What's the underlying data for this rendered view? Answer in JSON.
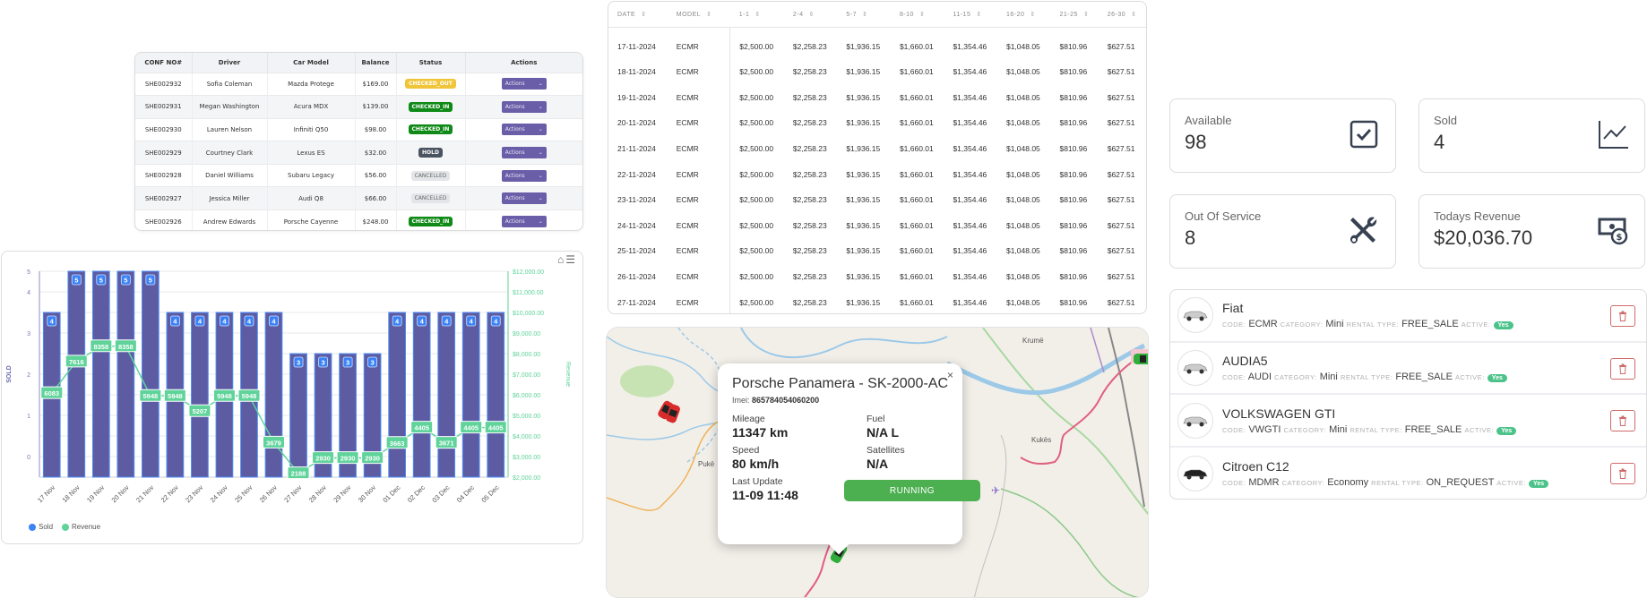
{
  "bookings": {
    "headers": [
      "CONF NO#",
      "Driver",
      "Car Model",
      "Balance",
      "Status",
      "Actions"
    ],
    "rows": [
      {
        "conf": "SHE002932",
        "driver": "Sofia Coleman",
        "model": "Mazda Protege",
        "balance": "$169.00",
        "status": "CHECKED_OUT",
        "action": "Actions"
      },
      {
        "conf": "SHE002931",
        "driver": "Megan Washington",
        "model": "Acura MDX",
        "balance": "$139.00",
        "status": "CHECKED_IN",
        "action": "Actions"
      },
      {
        "conf": "SHE002930",
        "driver": "Lauren Nelson",
        "model": "Infiniti Q50",
        "balance": "$98.00",
        "status": "CHECKED_IN",
        "action": "Actions"
      },
      {
        "conf": "SHE002929",
        "driver": "Courtney Clark",
        "model": "Lexus ES",
        "balance": "$32.00",
        "status": "HOLD",
        "action": "Actions"
      },
      {
        "conf": "SHE002928",
        "driver": "Daniel Williams",
        "model": "Subaru Legacy",
        "balance": "$56.00",
        "status": "CANCELLED",
        "action": "Actions"
      },
      {
        "conf": "SHE002927",
        "driver": "Jessica Miller",
        "model": "Audi Q8",
        "balance": "$66.00",
        "status": "CANCELLED",
        "action": "Actions"
      },
      {
        "conf": "SHE002926",
        "driver": "Andrew Edwards",
        "model": "Porsche Cayenne",
        "balance": "$248.00",
        "status": "CHECKED_IN",
        "action": "Actions"
      }
    ],
    "status_colors": {
      "CHECKED_OUT": "#f0c53a",
      "CHECKED_IN": "#0f8a17",
      "HOLD": "#4a5361",
      "CANCELLED": "#e3e5e8"
    },
    "action_color": "#6a5ea8"
  },
  "chart_data": {
    "type": "bar",
    "title": "",
    "categories": [
      "17 Nov",
      "18 Nov",
      "19 Nov",
      "20 Nov",
      "21 Nov",
      "22 Nov",
      "23 Nov",
      "24 Nov",
      "25 Nov",
      "26 Nov",
      "27 Nov",
      "28 Nov",
      "29 Nov",
      "30 Nov",
      "01 Dec",
      "02 Dec",
      "03 Dec",
      "04 Dec",
      "05 Dec"
    ],
    "series": [
      {
        "name": "Sold",
        "type": "bar",
        "axis": "left",
        "color": "#5d5ca3",
        "legend_color": "#3b82f6",
        "values": [
          4,
          5,
          5,
          5,
          5,
          4,
          4,
          4,
          4,
          4,
          3,
          3,
          3,
          3,
          4,
          4,
          4,
          4,
          4
        ]
      },
      {
        "name": "Revenue",
        "type": "line",
        "axis": "right",
        "color": "#5fd39a",
        "values": [
          6083,
          7616,
          8358,
          8358,
          5948,
          5948,
          5207,
          5948,
          5948,
          3679,
          2188,
          2930,
          2930,
          2930,
          3663,
          4405,
          3671,
          4405,
          4405
        ]
      }
    ],
    "ylabel": "SOLD",
    "y2label": "Revenue",
    "y_ticks": [
      "0",
      "1",
      "2",
      "3",
      "4",
      "5"
    ],
    "y2_ticks": [
      "$2,000.00",
      "$3,000.00",
      "$4,000.00",
      "$5,000.00",
      "$6,000.00",
      "$7,000.00",
      "$8,000.00",
      "$9,000.00",
      "$10,000.00",
      "$11,000.00",
      "$12,000.00"
    ],
    "y2lim": [
      2000,
      12000
    ],
    "grid": true,
    "legend": "bottom-left"
  },
  "chart_tools": {
    "home_icon": "home-icon",
    "menu_icon": "menu-icon"
  },
  "pricing": {
    "headers": [
      "DATE",
      "MODEL",
      "1-1",
      "2-4",
      "5-7",
      "8-10",
      "11-15",
      "16-20",
      "21-25",
      "26-30"
    ],
    "rows": [
      [
        "17-11-2024",
        "ECMR",
        "$2,500.00",
        "$2,258.23",
        "$1,936.15",
        "$1,660.01",
        "$1,354.46",
        "$1,048.05",
        "$810.96",
        "$627.51"
      ],
      [
        "18-11-2024",
        "ECMR",
        "$2,500.00",
        "$2,258.23",
        "$1,936.15",
        "$1,660.01",
        "$1,354.46",
        "$1,048.05",
        "$810.96",
        "$627.51"
      ],
      [
        "19-11-2024",
        "ECMR",
        "$2,500.00",
        "$2,258.23",
        "$1,936.15",
        "$1,660.01",
        "$1,354.46",
        "$1,048.05",
        "$810.96",
        "$627.51"
      ],
      [
        "20-11-2024",
        "ECMR",
        "$2,500.00",
        "$2,258.23",
        "$1,936.15",
        "$1,660.01",
        "$1,354.46",
        "$1,048.05",
        "$810.96",
        "$627.51"
      ],
      [
        "21-11-2024",
        "ECMR",
        "$2,500.00",
        "$2,258.23",
        "$1,936.15",
        "$1,660.01",
        "$1,354.46",
        "$1,048.05",
        "$810.96",
        "$627.51"
      ],
      [
        "22-11-2024",
        "ECMR",
        "$2,500.00",
        "$2,258.23",
        "$1,936.15",
        "$1,660.01",
        "$1,354.46",
        "$1,048.05",
        "$810.96",
        "$627.51"
      ],
      [
        "23-11-2024",
        "ECMR",
        "$2,500.00",
        "$2,258.23",
        "$1,936.15",
        "$1,660.01",
        "$1,354.46",
        "$1,048.05",
        "$810.96",
        "$627.51"
      ],
      [
        "24-11-2024",
        "ECMR",
        "$2,500.00",
        "$2,258.23",
        "$1,936.15",
        "$1,660.01",
        "$1,354.46",
        "$1,048.05",
        "$810.96",
        "$627.51"
      ],
      [
        "25-11-2024",
        "ECMR",
        "$2,500.00",
        "$2,258.23",
        "$1,936.15",
        "$1,660.01",
        "$1,354.46",
        "$1,048.05",
        "$810.96",
        "$627.51"
      ],
      [
        "26-11-2024",
        "ECMR",
        "$2,500.00",
        "$2,258.23",
        "$1,936.15",
        "$1,660.01",
        "$1,354.46",
        "$1,048.05",
        "$810.96",
        "$627.51"
      ],
      [
        "27-11-2024",
        "ECMR",
        "$2,500.00",
        "$2,258.23",
        "$1,936.15",
        "$1,660.01",
        "$1,354.46",
        "$1,048.05",
        "$810.96",
        "$627.51"
      ]
    ]
  },
  "map": {
    "labels": {
      "krume": "Krumë",
      "puke": "Pukë",
      "kukes": "Kukës"
    },
    "popup": {
      "title": "Porsche Panamera - SK-2000-AC",
      "imei_label": "Imei:",
      "imei": "865784054060200",
      "mileage_label": "Mileage",
      "mileage": "11347 km",
      "fuel_label": "Fuel",
      "fuel": "N/A L",
      "speed_label": "Speed",
      "speed": "80 km/h",
      "satellites_label": "Satellites",
      "satellites": "N/A",
      "last_update_label": "Last Update",
      "last_update": "11-09 11:48",
      "status_button": "RUNNING",
      "close": "×"
    }
  },
  "stats": [
    {
      "label": "Available",
      "value": "98",
      "icon": "checkbox-icon"
    },
    {
      "label": "Sold",
      "value": "4",
      "icon": "line-chart-icon"
    },
    {
      "label": "Out Of Service",
      "value": "8",
      "icon": "tools-icon"
    },
    {
      "label": "Todays Revenue",
      "value": "$20,036.70",
      "icon": "cash-icon"
    }
  ],
  "vehicles": {
    "keys": {
      "code": "CODE:",
      "category": "CATEGORY:",
      "rental_type": "RENTAL TYPE:",
      "active": "ACTIVE:"
    },
    "items": [
      {
        "name": "Fiat",
        "code": "ECMR",
        "category": "Mini",
        "rental_type": "FREE_SALE",
        "active": "Yes"
      },
      {
        "name": "AUDIA5",
        "code": "AUDI",
        "category": "Mini",
        "rental_type": "FREE_SALE",
        "active": "Yes"
      },
      {
        "name": "VOLKSWAGEN GTI",
        "code": "VWGTI",
        "category": "Mini",
        "rental_type": "FREE_SALE",
        "active": "Yes"
      },
      {
        "name": "Citroen C12",
        "code": "MDMR",
        "category": "Economy",
        "rental_type": "ON_REQUEST",
        "active": "Yes"
      }
    ]
  }
}
